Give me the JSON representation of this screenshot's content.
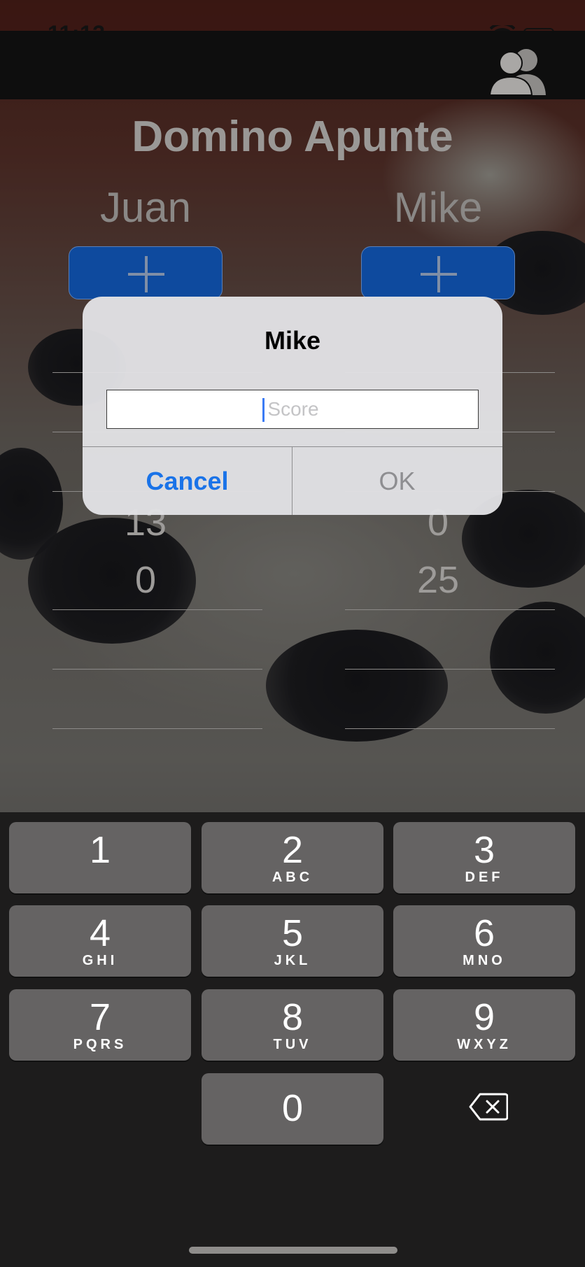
{
  "status_bar": {
    "time": "11:13"
  },
  "app": {
    "title": "Domino Apunte"
  },
  "players": [
    {
      "name": "Juan",
      "scores_visible": [
        "13",
        "0"
      ]
    },
    {
      "name": "Mike",
      "scores_visible": [
        "0",
        "25"
      ]
    }
  ],
  "alert": {
    "title": "Mike",
    "input_placeholder": "Score",
    "input_value": "",
    "cancel_label": "Cancel",
    "ok_label": "OK"
  },
  "keyboard": {
    "keys": [
      {
        "num": "1",
        "letters": ""
      },
      {
        "num": "2",
        "letters": "ABC"
      },
      {
        "num": "3",
        "letters": "DEF"
      },
      {
        "num": "4",
        "letters": "GHI"
      },
      {
        "num": "5",
        "letters": "JKL"
      },
      {
        "num": "6",
        "letters": "MNO"
      },
      {
        "num": "7",
        "letters": "PQRS"
      },
      {
        "num": "8",
        "letters": "TUV"
      },
      {
        "num": "9",
        "letters": "WXYZ"
      },
      {
        "num": "0",
        "letters": ""
      }
    ]
  },
  "colors": {
    "accent": "#1a73e8",
    "add_button": "#0e4a9e"
  }
}
